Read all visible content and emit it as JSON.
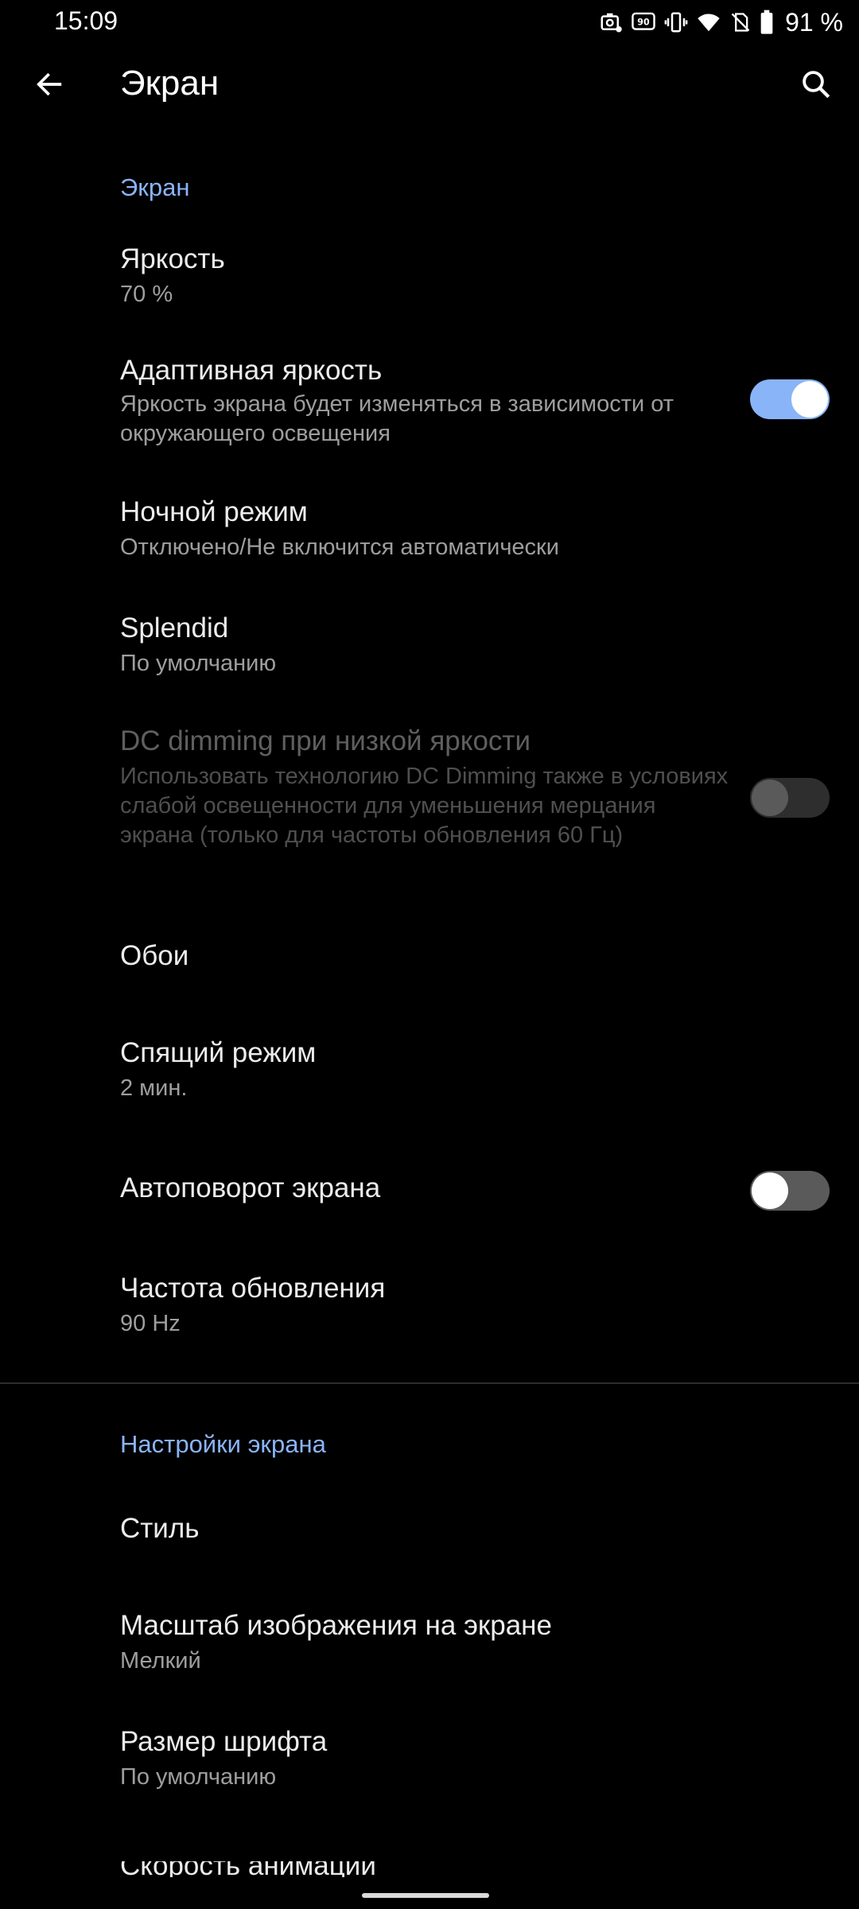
{
  "status": {
    "time": "15:09",
    "battery": "91 %",
    "icons": [
      "screenshot-icon",
      "refresh-rate-icon",
      "vibrate-icon",
      "wifi-icon",
      "no-sim-icon",
      "battery-icon"
    ]
  },
  "appbar": {
    "title": "Экран",
    "back_icon": "back-arrow-icon",
    "search_icon": "search-icon"
  },
  "sections": {
    "display": {
      "header": "Экран",
      "brightness": {
        "title": "Яркость",
        "value": "70 %"
      },
      "adaptive": {
        "title": "Адаптивная яркость",
        "desc": "Яркость экрана будет изменяться в зависимости от окружающего освещения",
        "enabled": true
      },
      "night": {
        "title": "Ночной режим",
        "value": "Отключено/Не включится автоматически"
      },
      "splendid": {
        "title": "Splendid",
        "value": "По умолчанию"
      },
      "dc_dimming": {
        "title": "DC dimming при низкой яркости",
        "desc": "Использовать технологию DC Dimming также в условиях слабой освещенности для уменьшения мерцания экрана (только для частоты обновления 60 Гц)",
        "enabled": false,
        "disabled": true
      },
      "wallpaper": {
        "title": "Обои"
      },
      "sleep": {
        "title": "Спящий режим",
        "value": "2 мин."
      },
      "autorotate": {
        "title": "Автоповорот экрана",
        "enabled": false
      },
      "refresh": {
        "title": "Частота обновления",
        "value": "90 Hz"
      }
    },
    "screen_settings": {
      "header": "Настройки экрана",
      "style": {
        "title": "Стиль"
      },
      "display_size": {
        "title": "Масштаб изображения на экране",
        "value": "Мелкий"
      },
      "font_size": {
        "title": "Размер шрифта",
        "value": "По умолчанию"
      },
      "animation": {
        "title": "Скорость анимации"
      }
    }
  },
  "colors": {
    "background": "#000000",
    "accent": "#8ab4f8",
    "text_primary": "#ececec",
    "text_secondary": "#9e9e9e"
  }
}
